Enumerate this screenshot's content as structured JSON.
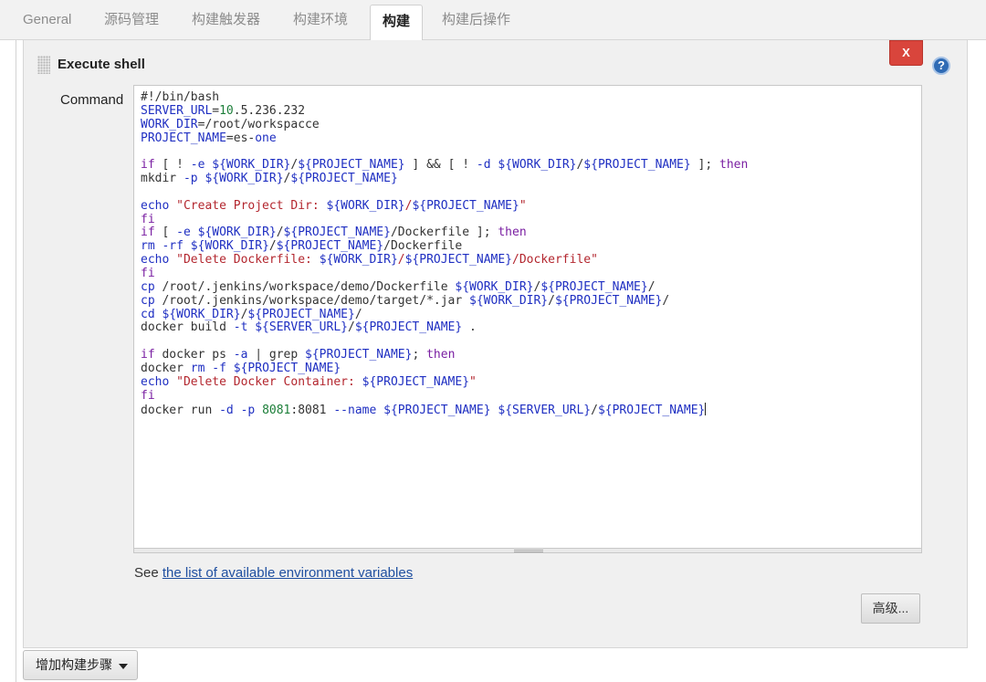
{
  "tabs": [
    {
      "label": "General"
    },
    {
      "label": "源码管理"
    },
    {
      "label": "构建触发器"
    },
    {
      "label": "构建环境"
    },
    {
      "label": "构建",
      "active": true
    },
    {
      "label": "构建后操作"
    }
  ],
  "step": {
    "title": "Execute shell",
    "delete_label": "X",
    "help_label": "?",
    "command_label": "Command"
  },
  "script_lines": [
    [
      {
        "t": "#!/bin/bash",
        "c": "tx"
      }
    ],
    [
      {
        "t": "SERVER_URL",
        "c": "vr"
      },
      {
        "t": "=",
        "c": "tx"
      },
      {
        "t": "10",
        "c": "nm"
      },
      {
        "t": ".5.236.232",
        "c": "tx"
      }
    ],
    [
      {
        "t": "WORK_DIR",
        "c": "vr"
      },
      {
        "t": "=/root/workspacce",
        "c": "tx"
      }
    ],
    [
      {
        "t": "PROJECT_NAME",
        "c": "vr"
      },
      {
        "t": "=es-",
        "c": "tx"
      },
      {
        "t": "one",
        "c": "vr"
      }
    ],
    [],
    [
      {
        "t": "if",
        "c": "kw"
      },
      {
        "t": " [ ! ",
        "c": "tx"
      },
      {
        "t": "-e",
        "c": "vr"
      },
      {
        "t": " ",
        "c": "tx"
      },
      {
        "t": "${WORK_DIR}",
        "c": "vr"
      },
      {
        "t": "/",
        "c": "tx"
      },
      {
        "t": "${PROJECT_NAME}",
        "c": "vr"
      },
      {
        "t": " ] && [ ! ",
        "c": "tx"
      },
      {
        "t": "-d",
        "c": "vr"
      },
      {
        "t": " ",
        "c": "tx"
      },
      {
        "t": "${WORK_DIR}",
        "c": "vr"
      },
      {
        "t": "/",
        "c": "tx"
      },
      {
        "t": "${PROJECT_NAME}",
        "c": "vr"
      },
      {
        "t": " ]; ",
        "c": "tx"
      },
      {
        "t": "then",
        "c": "kw"
      }
    ],
    [
      {
        "t": "mkdir ",
        "c": "tx"
      },
      {
        "t": "-p",
        "c": "vr"
      },
      {
        "t": " ",
        "c": "tx"
      },
      {
        "t": "${WORK_DIR}",
        "c": "vr"
      },
      {
        "t": "/",
        "c": "tx"
      },
      {
        "t": "${PROJECT_NAME}",
        "c": "vr"
      }
    ],
    [],
    [
      {
        "t": "echo",
        "c": "vr"
      },
      {
        "t": " ",
        "c": "tx"
      },
      {
        "t": "\"Create Project Dir: ",
        "c": "st"
      },
      {
        "t": "${WORK_DIR}",
        "c": "vr"
      },
      {
        "t": "/",
        "c": "st"
      },
      {
        "t": "${PROJECT_NAME}",
        "c": "vr"
      },
      {
        "t": "\"",
        "c": "st"
      }
    ],
    [
      {
        "t": "fi",
        "c": "kw"
      }
    ],
    [
      {
        "t": "if",
        "c": "kw"
      },
      {
        "t": " [ ",
        "c": "tx"
      },
      {
        "t": "-e",
        "c": "vr"
      },
      {
        "t": " ",
        "c": "tx"
      },
      {
        "t": "${WORK_DIR}",
        "c": "vr"
      },
      {
        "t": "/",
        "c": "tx"
      },
      {
        "t": "${PROJECT_NAME}",
        "c": "vr"
      },
      {
        "t": "/Dockerfile ]; ",
        "c": "tx"
      },
      {
        "t": "then",
        "c": "kw"
      }
    ],
    [
      {
        "t": "rm",
        "c": "vr"
      },
      {
        "t": " ",
        "c": "tx"
      },
      {
        "t": "-rf",
        "c": "vr"
      },
      {
        "t": " ",
        "c": "tx"
      },
      {
        "t": "${WORK_DIR}",
        "c": "vr"
      },
      {
        "t": "/",
        "c": "tx"
      },
      {
        "t": "${PROJECT_NAME}",
        "c": "vr"
      },
      {
        "t": "/Dockerfile",
        "c": "tx"
      }
    ],
    [
      {
        "t": "echo",
        "c": "vr"
      },
      {
        "t": " ",
        "c": "tx"
      },
      {
        "t": "\"Delete Dockerfile: ",
        "c": "st"
      },
      {
        "t": "${WORK_DIR}",
        "c": "vr"
      },
      {
        "t": "/",
        "c": "st"
      },
      {
        "t": "${PROJECT_NAME}",
        "c": "vr"
      },
      {
        "t": "/Dockerfile\"",
        "c": "st"
      }
    ],
    [
      {
        "t": "fi",
        "c": "kw"
      }
    ],
    [
      {
        "t": "cp",
        "c": "vr"
      },
      {
        "t": " /root/.jenkins/workspace/demo/Dockerfile ",
        "c": "tx"
      },
      {
        "t": "${WORK_DIR}",
        "c": "vr"
      },
      {
        "t": "/",
        "c": "tx"
      },
      {
        "t": "${PROJECT_NAME}",
        "c": "vr"
      },
      {
        "t": "/",
        "c": "tx"
      }
    ],
    [
      {
        "t": "cp",
        "c": "vr"
      },
      {
        "t": " /root/.jenkins/workspace/demo/target/*.jar ",
        "c": "tx"
      },
      {
        "t": "${WORK_DIR}",
        "c": "vr"
      },
      {
        "t": "/",
        "c": "tx"
      },
      {
        "t": "${PROJECT_NAME}",
        "c": "vr"
      },
      {
        "t": "/",
        "c": "tx"
      }
    ],
    [
      {
        "t": "cd",
        "c": "vr"
      },
      {
        "t": " ",
        "c": "tx"
      },
      {
        "t": "${WORK_DIR}",
        "c": "vr"
      },
      {
        "t": "/",
        "c": "tx"
      },
      {
        "t": "${PROJECT_NAME}",
        "c": "vr"
      },
      {
        "t": "/",
        "c": "tx"
      }
    ],
    [
      {
        "t": "docker build ",
        "c": "tx"
      },
      {
        "t": "-t",
        "c": "vr"
      },
      {
        "t": " ",
        "c": "tx"
      },
      {
        "t": "${SERVER_URL}",
        "c": "vr"
      },
      {
        "t": "/",
        "c": "tx"
      },
      {
        "t": "${PROJECT_NAME}",
        "c": "vr"
      },
      {
        "t": " .",
        "c": "tx"
      }
    ],
    [],
    [
      {
        "t": "if",
        "c": "kw"
      },
      {
        "t": " docker ps ",
        "c": "tx"
      },
      {
        "t": "-a",
        "c": "vr"
      },
      {
        "t": " | grep ",
        "c": "tx"
      },
      {
        "t": "${PROJECT_NAME}",
        "c": "vr"
      },
      {
        "t": "; ",
        "c": "tx"
      },
      {
        "t": "then",
        "c": "kw"
      }
    ],
    [
      {
        "t": "docker ",
        "c": "tx"
      },
      {
        "t": "rm",
        "c": "vr"
      },
      {
        "t": " ",
        "c": "tx"
      },
      {
        "t": "-f",
        "c": "vr"
      },
      {
        "t": " ",
        "c": "tx"
      },
      {
        "t": "${PROJECT_NAME}",
        "c": "vr"
      }
    ],
    [
      {
        "t": "echo",
        "c": "vr"
      },
      {
        "t": " ",
        "c": "tx"
      },
      {
        "t": "\"Delete Docker Container: ",
        "c": "st"
      },
      {
        "t": "${PROJECT_NAME}",
        "c": "vr"
      },
      {
        "t": "\"",
        "c": "st"
      }
    ],
    [
      {
        "t": "fi",
        "c": "kw"
      }
    ],
    [
      {
        "t": "docker run ",
        "c": "tx"
      },
      {
        "t": "-d",
        "c": "vr"
      },
      {
        "t": " ",
        "c": "tx"
      },
      {
        "t": "-p",
        "c": "vr"
      },
      {
        "t": " ",
        "c": "tx"
      },
      {
        "t": "8081",
        "c": "nm"
      },
      {
        "t": ":8081 ",
        "c": "tx"
      },
      {
        "t": "--name",
        "c": "vr"
      },
      {
        "t": " ",
        "c": "tx"
      },
      {
        "t": "${PROJECT_NAME}",
        "c": "vr"
      },
      {
        "t": " ",
        "c": "tx"
      },
      {
        "t": "${SERVER_URL}",
        "c": "vr"
      },
      {
        "t": "/",
        "c": "tx"
      },
      {
        "t": "${PROJECT_NAME}",
        "c": "vr"
      }
    ]
  ],
  "footer": {
    "see_prefix": "See",
    "env_vars_link": "the list of available environment variables",
    "advanced_button": "高级...",
    "add_step_button": "增加构建步骤"
  },
  "colors": {
    "keyword": "#7a1fa2",
    "variable": "#1f2fc2",
    "string": "#b3262e",
    "number": "#1d7f3a",
    "delete_button": "#d9453c",
    "link": "#1f4fa0"
  },
  "icons": [
    "drag-handle-icon",
    "help-icon",
    "chevron-down-icon"
  ]
}
